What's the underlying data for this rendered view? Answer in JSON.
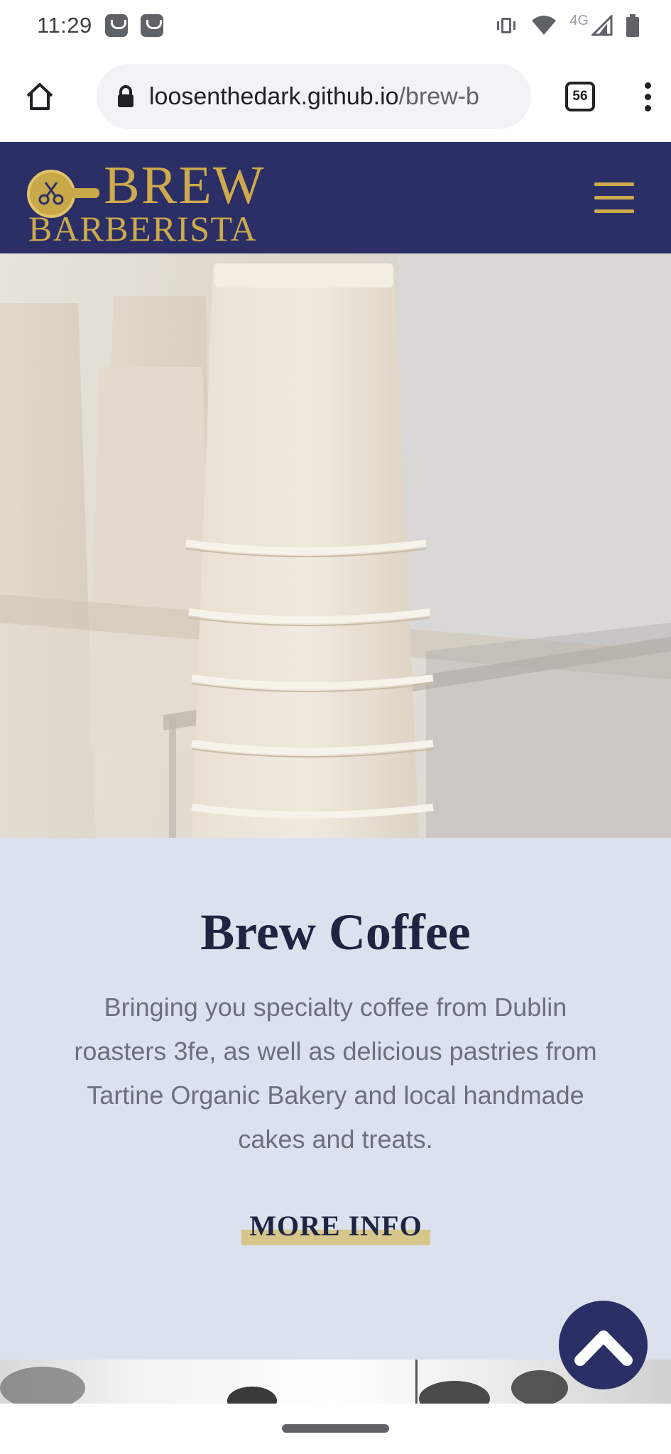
{
  "status_bar": {
    "time": "11:29",
    "network": "4G"
  },
  "browser": {
    "url_domain": "loosenthedark.github.io",
    "url_path": "/brew-b",
    "tab_count": "56"
  },
  "header": {
    "logo_line1": "BREW",
    "logo_line2": "BARBERISTA"
  },
  "info": {
    "title": "Brew Coffee",
    "description": "Bringing you specialty coffee from Dublin roasters 3fe, as well as delicious pastries from Tartine Organic Bakery and local handmade cakes and treats.",
    "more_info_label": "MORE INFO"
  },
  "colors": {
    "navy": "#2b2f66",
    "gold": "#cdaa4c",
    "section_bg": "#dbe2ed",
    "highlight": "#d6c68c"
  }
}
